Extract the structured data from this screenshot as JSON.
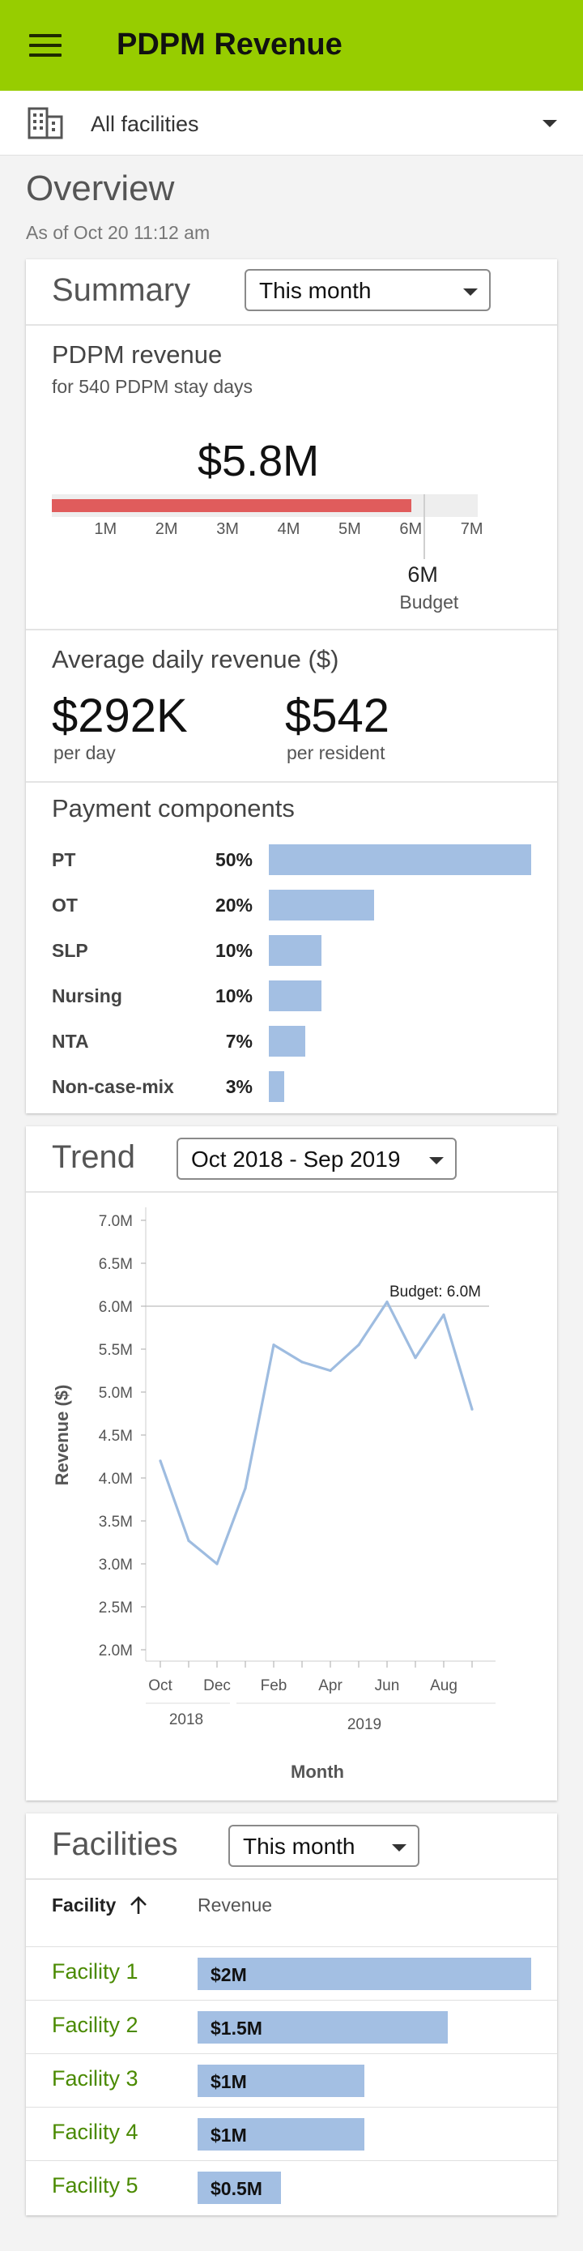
{
  "app": {
    "title": "PDPM Revenue",
    "facility_selector": "All facilities",
    "brand_color": "#97cd00"
  },
  "overview": {
    "title": "Overview",
    "as_of": "As of Oct 20 11:12 am"
  },
  "summary": {
    "title": "Summary",
    "period": "This month",
    "pdpm": {
      "title": "PDPM revenue",
      "subtitle": "for 540 PDPM stay days",
      "value_label": "$5.8M",
      "value": 5.8,
      "budget_value": 6,
      "budget_label": "6M",
      "budget_caption": "Budget",
      "scale_ticks": [
        "1M",
        "2M",
        "3M",
        "4M",
        "5M",
        "6M",
        "7M"
      ],
      "bar_color": "#e05c5c"
    },
    "average_daily": {
      "title": "Average daily revenue ($)",
      "per_day_value": "$292K",
      "per_day_label": "per day",
      "per_resident_value": "$542",
      "per_resident_label": "per resident"
    },
    "components": {
      "title": "Payment components",
      "items": [
        {
          "label": "PT",
          "pct": "50%",
          "value": 50
        },
        {
          "label": "OT",
          "pct": "20%",
          "value": 20
        },
        {
          "label": "SLP",
          "pct": "10%",
          "value": 10
        },
        {
          "label": "Nursing",
          "pct": "10%",
          "value": 10
        },
        {
          "label": "NTA",
          "pct": "7%",
          "value": 7
        },
        {
          "label": "Non-case-mix",
          "pct": "3%",
          "value": 3
        }
      ]
    }
  },
  "trend": {
    "title": "Trend",
    "period": "Oct 2018 - Sep 2019"
  },
  "chart_data": {
    "type": "line",
    "title": "",
    "xlabel": "Month",
    "ylabel": "Revenue ($)",
    "x": [
      "2018-10",
      "2018-11",
      "2018-12",
      "2019-01",
      "2019-02",
      "2019-03",
      "2019-04",
      "2019-05",
      "2019-06",
      "2019-07",
      "2019-08",
      "2019-09"
    ],
    "x_tick_labels": [
      "Oct",
      "Dec",
      "Feb",
      "Apr",
      "Jun",
      "Aug"
    ],
    "x_year_labels": [
      "2018",
      "2019"
    ],
    "y_tick_labels": [
      "2.0M",
      "2.5M",
      "3.0M",
      "3.5M",
      "4.0M",
      "4.5M",
      "5.0M",
      "5.5M",
      "6.0M",
      "6.5M",
      "7.0M"
    ],
    "ylim": [
      2.0,
      7.0
    ],
    "series": [
      {
        "values": [
          4.2,
          3.27,
          3.0,
          3.88,
          5.55,
          5.35,
          5.25,
          5.55,
          6.05,
          5.4,
          5.9,
          4.8
        ],
        "color": "#9ebce0"
      }
    ],
    "budget_line": {
      "value": 6.0,
      "label": "Budget: 6.0M"
    },
    "grid": false
  },
  "facilities": {
    "title": "Facilities",
    "period": "This month",
    "col_facility": "Facility",
    "col_revenue": "Revenue",
    "rows": [
      {
        "name": "Facility 1",
        "revenue_label": "$2M",
        "value": 2.0
      },
      {
        "name": "Facility 2",
        "revenue_label": "$1.5M",
        "value": 1.5
      },
      {
        "name": "Facility 3",
        "revenue_label": "$1M",
        "value": 1.0
      },
      {
        "name": "Facility 4",
        "revenue_label": "$1M",
        "value": 1.0
      },
      {
        "name": "Facility 5",
        "revenue_label": "$0.5M",
        "value": 0.5
      }
    ]
  }
}
